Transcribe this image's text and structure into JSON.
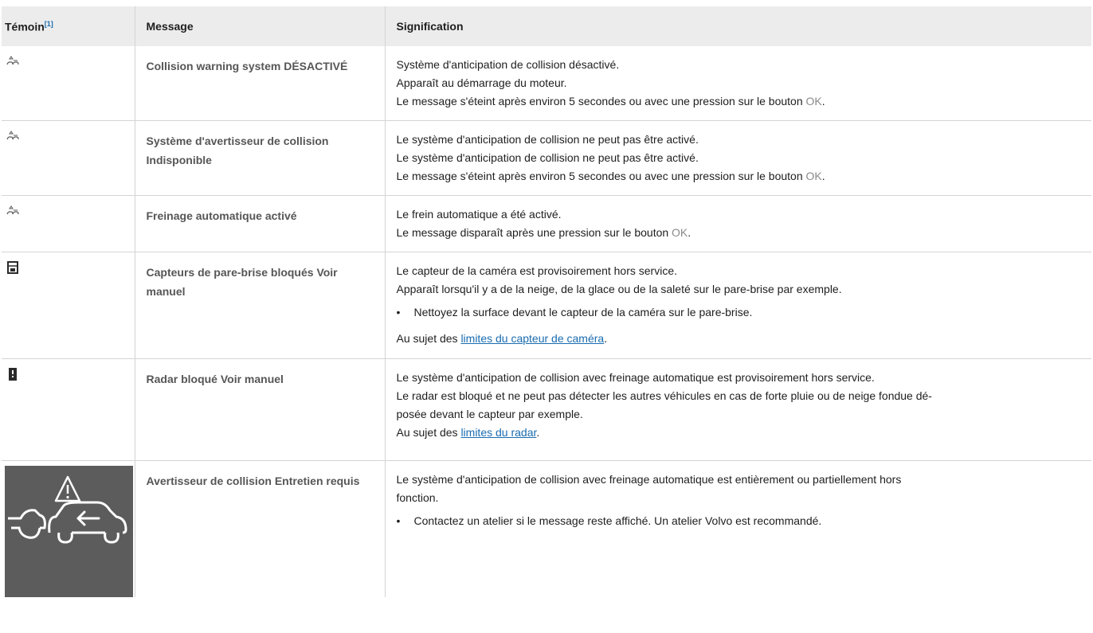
{
  "header": {
    "col1": "Témoin",
    "col1_note": "[1]",
    "col2": "Message",
    "col3": "Signification"
  },
  "rows": [
    {
      "icon": "collision-warning-icon",
      "message": "Collision warning system DÉSACTIVÉ",
      "lines": [
        "Système d'anticipation de collision désactivé.",
        "Apparaît au démarrage du moteur.",
        "Le message s'éteint après environ 5 secondes ou avec une pression sur le bouton "
      ],
      "ok": "OK",
      "end": "."
    },
    {
      "icon": "collision-warning-icon",
      "message": "Système d'avertisseur de collision Indisponible",
      "lines": [
        "Le système d'anticipation de collision ne peut pas être activé.",
        "Le système d'anticipation de collision ne peut pas être activé.",
        "Le message s'éteint après environ 5 secondes ou avec une pression sur le bouton "
      ],
      "ok": "OK",
      "end": "."
    },
    {
      "icon": "collision-warning-icon",
      "message": "Freinage automatique activé",
      "lines": [
        "Le frein automatique a été activé.",
        "Le message disparaît après une pression sur le bouton "
      ],
      "ok": "OK",
      "end": "."
    },
    {
      "icon": "windscreen-sensor-icon",
      "message": "Capteurs de pare-brise bloqués Voir manuel",
      "lines": [
        "Le capteur de la caméra est provisoirement hors service.",
        "Apparaît lorsqu'il y a de la neige, de la glace ou de la saleté sur le pare-brise par exemple."
      ],
      "bullet": "Nettoyez la surface devant le capteur de la caméra sur le pare-brise.",
      "ref_prefix": "Au sujet des ",
      "ref_link": "limites du capteur de caméra",
      "ref_suffix": "."
    },
    {
      "icon": "radar-icon",
      "message": "Radar bloqué Voir manuel",
      "lines": [
        "Le système d'anticipation de collision avec freinage automatique est provisoirement hors service.",
        "Le radar est bloqué et ne peut pas détecter les autres véhicules en cas de forte pluie ou de neige fondue dé-",
        "posée devant le capteur par exemple."
      ],
      "ref_prefix": "Au sujet des ",
      "ref_link": "limites du radar",
      "ref_suffix": "."
    },
    {
      "icon": "collision-service-icon",
      "message": "Avertisseur de collision Entretien requis",
      "lines": [
        "Le système d'anticipation de collision avec freinage automatique est entièrement ou partiellement hors",
        "fonction."
      ],
      "bullet": "Contactez un atelier si le message reste affiché. Un atelier Volvo est recommandé."
    }
  ],
  "colors": {
    "link": "#1a6cb0",
    "header_bg": "#ececec",
    "icon_bg": "#5c5c5c"
  }
}
